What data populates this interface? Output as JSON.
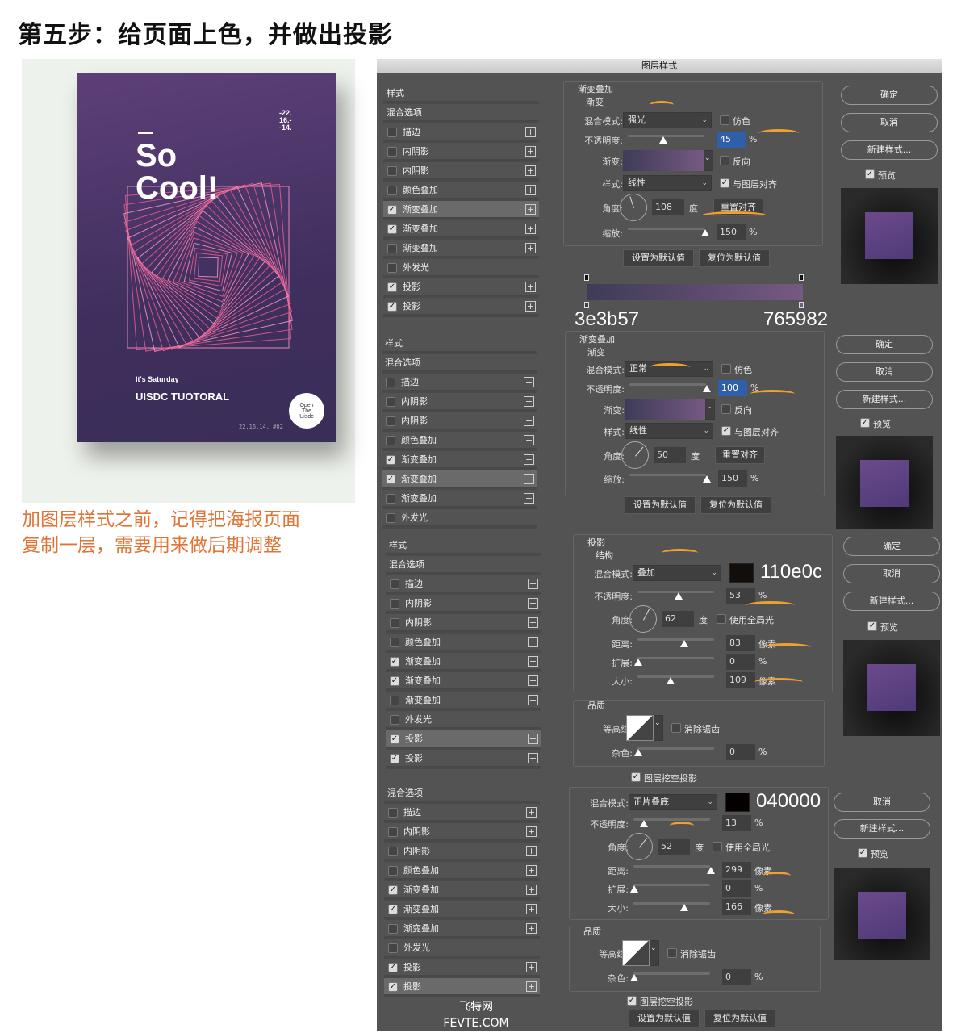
{
  "page_title": "第五步：给页面上色，并做出投影",
  "caption": [
    "加图层样式之前，记得把海报页面",
    "复制一层，需要用来做后期调整"
  ],
  "accent_color": "#e07436",
  "poster": {
    "dates": [
      "-22.",
      "16.-",
      "-14."
    ],
    "headline": [
      "So",
      "Cool!"
    ],
    "subtitle": "It's Saturday",
    "brand": "UISDC TUOTORAL",
    "badge": [
      "Open",
      "The",
      "Uisdc"
    ],
    "footer": "22.16.14.  #02",
    "background_color": "#4a3468"
  },
  "dialog": {
    "title": "图层样式",
    "gradient_stops": {
      "start": "3e3b57",
      "end": "765982"
    }
  },
  "panels": [
    {
      "list": [
        {
          "label": "样式",
          "header": true
        },
        {
          "label": "混合选项",
          "header": true
        },
        {
          "label": "描边",
          "checked": false,
          "plus": true
        },
        {
          "label": "内阴影",
          "checked": false,
          "plus": true
        },
        {
          "label": "内阴影",
          "checked": false,
          "plus": true
        },
        {
          "label": "颜色叠加",
          "checked": false,
          "plus": true
        },
        {
          "label": "渐变叠加",
          "checked": true,
          "plus": true,
          "selected": true
        },
        {
          "label": "渐变叠加",
          "checked": true,
          "plus": true
        },
        {
          "label": "渐变叠加",
          "checked": false,
          "plus": true
        },
        {
          "label": "外发光",
          "checked": false
        },
        {
          "label": "投影",
          "checked": true,
          "plus": true
        },
        {
          "label": "投影",
          "checked": true,
          "plus": true
        }
      ],
      "section": "渐变叠加",
      "group": "渐变",
      "rows": [
        {
          "type": "select",
          "label": "混合模式:",
          "value": "强光",
          "check": {
            "label": "仿色",
            "checked": false
          }
        },
        {
          "type": "slider",
          "label": "不透明度:",
          "value": "45",
          "unit": "%",
          "fraction": 0.45,
          "highlight": true
        },
        {
          "type": "gradient",
          "label": "渐变:",
          "check": {
            "label": "反向",
            "checked": false
          }
        },
        {
          "type": "select",
          "label": "样式:",
          "value": "线性",
          "check": {
            "label": "与图层对齐",
            "checked": true
          }
        },
        {
          "type": "angle",
          "label": "角度:",
          "value": "108",
          "unit": "度",
          "deg": 108,
          "button": "重置对齐"
        },
        {
          "type": "slider",
          "label": "缩放:",
          "value": "150",
          "unit": "%",
          "fraction": 1.0
        }
      ],
      "bottom_buttons": [
        "设置为默认值",
        "复位为默认值"
      ],
      "right_buttons": [
        "确定",
        "取消",
        "新建样式..."
      ],
      "preview": {
        "label": "预览",
        "checked": true
      }
    },
    {
      "list": [
        {
          "label": "样式",
          "header": true
        },
        {
          "label": "混合选项",
          "header": true
        },
        {
          "label": "描边",
          "checked": false,
          "plus": true
        },
        {
          "label": "内阴影",
          "checked": false,
          "plus": true
        },
        {
          "label": "内阴影",
          "checked": false,
          "plus": true
        },
        {
          "label": "颜色叠加",
          "checked": false,
          "plus": true
        },
        {
          "label": "渐变叠加",
          "checked": true,
          "plus": true
        },
        {
          "label": "渐变叠加",
          "checked": true,
          "plus": true,
          "selected": true
        },
        {
          "label": "渐变叠加",
          "checked": false,
          "plus": true
        },
        {
          "label": "外发光",
          "checked": false
        }
      ],
      "section": "渐变叠加",
      "group": "渐变",
      "rows": [
        {
          "type": "select",
          "label": "混合模式:",
          "value": "正常",
          "check": {
            "label": "仿色",
            "checked": false
          }
        },
        {
          "type": "slider",
          "label": "不透明度:",
          "value": "100",
          "unit": "%",
          "fraction": 1.0,
          "highlight": true
        },
        {
          "type": "gradient",
          "label": "渐变:",
          "check": {
            "label": "反向",
            "checked": false
          }
        },
        {
          "type": "select",
          "label": "样式:",
          "value": "线性",
          "check": {
            "label": "与图层对齐",
            "checked": true
          }
        },
        {
          "type": "angle",
          "label": "角度:",
          "value": "50",
          "unit": "度",
          "deg": 50,
          "button": "重置对齐"
        },
        {
          "type": "slider",
          "label": "缩放:",
          "value": "150",
          "unit": "%",
          "fraction": 1.0
        }
      ],
      "bottom_buttons": [
        "设置为默认值",
        "复位为默认值"
      ],
      "right_buttons": [
        "确定",
        "取消",
        "新建样式..."
      ],
      "preview": {
        "label": "预览",
        "checked": true
      }
    },
    {
      "list": [
        {
          "label": "样式",
          "header": true
        },
        {
          "label": "混合选项",
          "header": true
        },
        {
          "label": "描边",
          "checked": false,
          "plus": true
        },
        {
          "label": "内阴影",
          "checked": false,
          "plus": true
        },
        {
          "label": "内阴影",
          "checked": false,
          "plus": true
        },
        {
          "label": "颜色叠加",
          "checked": false,
          "plus": true
        },
        {
          "label": "渐变叠加",
          "checked": true,
          "plus": true
        },
        {
          "label": "渐变叠加",
          "checked": true,
          "plus": true
        },
        {
          "label": "渐变叠加",
          "checked": false,
          "plus": true
        },
        {
          "label": "外发光",
          "checked": false
        },
        {
          "label": "投影",
          "checked": true,
          "plus": true,
          "selected": true
        },
        {
          "label": "投影",
          "checked": true,
          "plus": true
        }
      ],
      "section": "投影",
      "group": "结构",
      "rows": [
        {
          "type": "select",
          "label": "混合模式:",
          "value": "叠加",
          "color": "#110e0c",
          "hex": "110e0c"
        },
        {
          "type": "slider",
          "label": "不透明度:",
          "value": "53",
          "unit": "%",
          "fraction": 0.53
        },
        {
          "type": "angle",
          "label": "角度:",
          "value": "62",
          "unit": "度",
          "deg": 62,
          "check": {
            "label": "使用全局光",
            "checked": false
          }
        },
        {
          "type": "slider",
          "label": "距离:",
          "value": "83",
          "unit": "像素",
          "fraction": 0.6
        },
        {
          "type": "slider",
          "label": "扩展:",
          "value": "0",
          "unit": "%",
          "fraction": 0
        },
        {
          "type": "slider",
          "label": "大小:",
          "value": "109",
          "unit": "像素",
          "fraction": 0.42
        }
      ],
      "quality": {
        "title": "品质",
        "contour_label": "等高线:",
        "antialias": {
          "label": "消除锯齿",
          "checked": false
        },
        "noise_label": "杂色:",
        "noise_value": "0",
        "noise_unit": "%"
      },
      "knockout": {
        "label": "图层挖空投影",
        "checked": true
      },
      "right_buttons": [
        "确定",
        "取消",
        "新建样式..."
      ],
      "preview": {
        "label": "预览",
        "checked": true
      }
    },
    {
      "list": [
        {
          "label": "混合选项",
          "header": true
        },
        {
          "label": "描边",
          "checked": false,
          "plus": true
        },
        {
          "label": "内阴影",
          "checked": false,
          "plus": true
        },
        {
          "label": "内阴影",
          "checked": false,
          "plus": true
        },
        {
          "label": "颜色叠加",
          "checked": false,
          "plus": true
        },
        {
          "label": "渐变叠加",
          "checked": true,
          "plus": true
        },
        {
          "label": "渐变叠加",
          "checked": true,
          "plus": true
        },
        {
          "label": "渐变叠加",
          "checked": false,
          "plus": true
        },
        {
          "label": "外发光",
          "checked": false
        },
        {
          "label": "投影",
          "checked": true,
          "plus": true
        },
        {
          "label": "投影",
          "checked": true,
          "plus": true,
          "selected": true
        }
      ],
      "rows": [
        {
          "type": "select",
          "label": "混合模式:",
          "value": "正片叠底",
          "color": "#040000",
          "hex": "040000"
        },
        {
          "type": "slider",
          "label": "不透明度:",
          "value": "13",
          "unit": "%",
          "fraction": 0.13
        },
        {
          "type": "angle",
          "label": "角度:",
          "value": "52",
          "unit": "度",
          "deg": 52,
          "check": {
            "label": "使用全局光",
            "checked": false
          }
        },
        {
          "type": "slider",
          "label": "距离:",
          "value": "299",
          "unit": "像素",
          "fraction": 1.0
        },
        {
          "type": "slider",
          "label": "扩展:",
          "value": "0",
          "unit": "%",
          "fraction": 0
        },
        {
          "type": "slider",
          "label": "大小:",
          "value": "166",
          "unit": "像素",
          "fraction": 0.65
        }
      ],
      "quality": {
        "title": "品质",
        "contour_label": "等高线:",
        "antialias": {
          "label": "消除锯齿",
          "checked": false
        },
        "noise_label": "杂色:",
        "noise_value": "0",
        "noise_unit": "%"
      },
      "knockout": {
        "label": "图层挖空投影",
        "checked": true
      },
      "bottom_buttons": [
        "设置为默认值",
        "复位为默认值"
      ],
      "right_buttons": [
        "取消",
        "新建样式..."
      ],
      "preview": {
        "label": "预览",
        "checked": true
      }
    }
  ],
  "watermark": [
    "飞特网",
    "FEVTE.COM"
  ]
}
